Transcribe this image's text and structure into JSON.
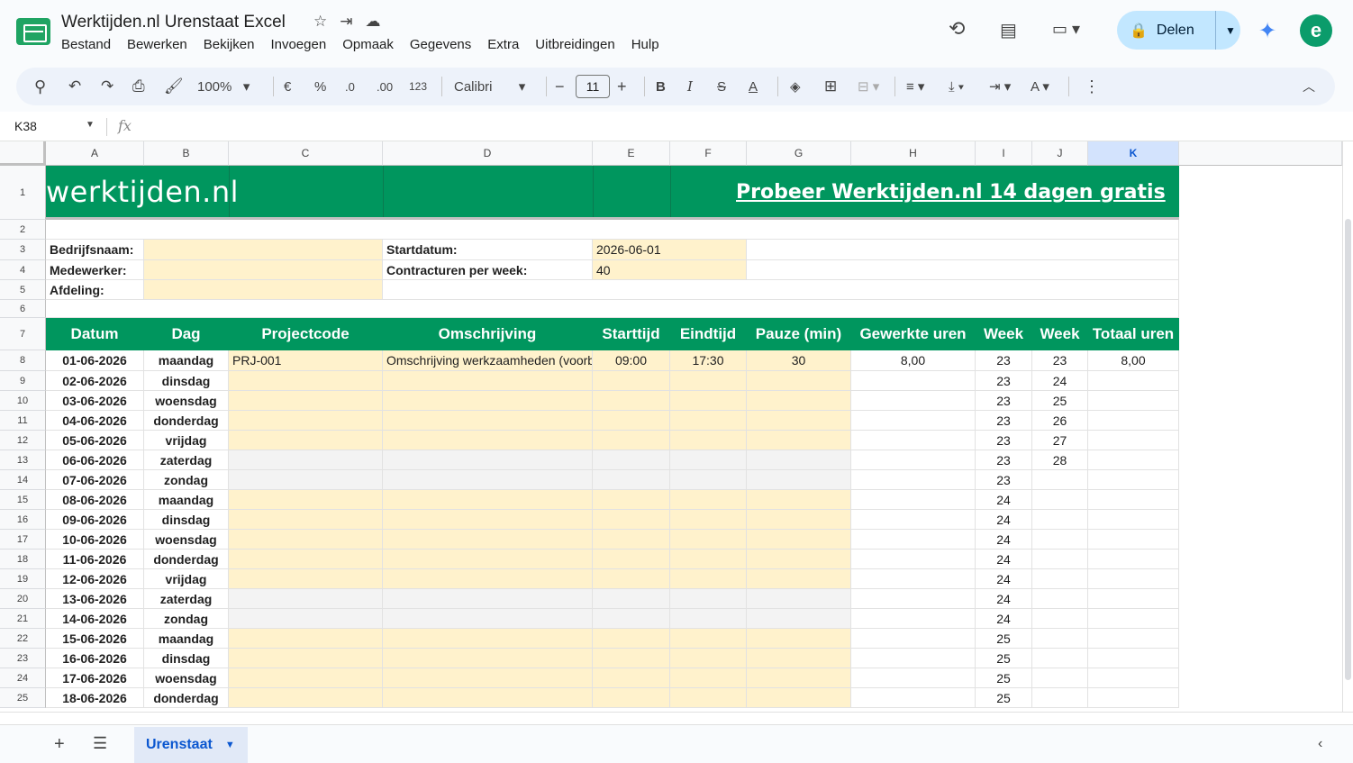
{
  "app": {
    "title": "Werktijden.nl Urenstaat Excel",
    "menu": [
      "Bestand",
      "Bewerken",
      "Bekijken",
      "Invoegen",
      "Opmaak",
      "Gegevens",
      "Extra",
      "Uitbreidingen",
      "Hulp"
    ],
    "share_label": "Delen",
    "avatar_letter": "e"
  },
  "toolbar": {
    "zoom": "100%",
    "currency": "€",
    "percent": "%",
    "dec_less": ".0",
    "dec_more": ".00",
    "number_format": "123",
    "font": "Calibri",
    "font_size": "11"
  },
  "formula_bar": {
    "cell_ref": "K38",
    "fx": "fx",
    "value": ""
  },
  "columns": [
    "A",
    "B",
    "C",
    "D",
    "E",
    "F",
    "G",
    "H",
    "I",
    "J",
    "K"
  ],
  "selected_column": "K",
  "banner": {
    "brand": "werktijden.nl",
    "promo": "Probeer Werktijden.nl 14 dagen gratis"
  },
  "form": {
    "bedrijfsnaam_label": "Bedrijfsnaam:",
    "medewerker_label": "Medewerker:",
    "afdeling_label": "Afdeling:",
    "startdatum_label": "Startdatum:",
    "startdatum_value": "2026-06-01",
    "contracturen_label": "Contracturen per week:",
    "contracturen_value": "40"
  },
  "table_headers": [
    "Datum",
    "Dag",
    "Projectcode",
    "Omschrijving",
    "Starttijd",
    "Eindtijd",
    "Pauze (min)",
    "Gewerkte uren",
    "Week",
    "Week",
    "Totaal uren"
  ],
  "rows": [
    {
      "num": "8",
      "datum": "01-06-2026",
      "dag": "maandag",
      "project": "PRJ-001",
      "omschrijving": "Omschrijving werkzaamheden (voorbeeld)",
      "start": "09:00",
      "eind": "17:30",
      "pauze": "30",
      "uren": "8,00",
      "week": "23",
      "week2": "23",
      "totaal": "8,00",
      "weekend": false
    },
    {
      "num": "9",
      "datum": "02-06-2026",
      "dag": "dinsdag",
      "project": "",
      "omschrijving": "",
      "start": "",
      "eind": "",
      "pauze": "",
      "uren": "",
      "week": "23",
      "week2": "24",
      "totaal": "",
      "weekend": false
    },
    {
      "num": "10",
      "datum": "03-06-2026",
      "dag": "woensdag",
      "project": "",
      "omschrijving": "",
      "start": "",
      "eind": "",
      "pauze": "",
      "uren": "",
      "week": "23",
      "week2": "25",
      "totaal": "",
      "weekend": false
    },
    {
      "num": "11",
      "datum": "04-06-2026",
      "dag": "donderdag",
      "project": "",
      "omschrijving": "",
      "start": "",
      "eind": "",
      "pauze": "",
      "uren": "",
      "week": "23",
      "week2": "26",
      "totaal": "",
      "weekend": false
    },
    {
      "num": "12",
      "datum": "05-06-2026",
      "dag": "vrijdag",
      "project": "",
      "omschrijving": "",
      "start": "",
      "eind": "",
      "pauze": "",
      "uren": "",
      "week": "23",
      "week2": "27",
      "totaal": "",
      "weekend": false
    },
    {
      "num": "13",
      "datum": "06-06-2026",
      "dag": "zaterdag",
      "project": "",
      "omschrijving": "",
      "start": "",
      "eind": "",
      "pauze": "",
      "uren": "",
      "week": "23",
      "week2": "28",
      "totaal": "",
      "weekend": true
    },
    {
      "num": "14",
      "datum": "07-06-2026",
      "dag": "zondag",
      "project": "",
      "omschrijving": "",
      "start": "",
      "eind": "",
      "pauze": "",
      "uren": "",
      "week": "23",
      "week2": "",
      "totaal": "",
      "weekend": true
    },
    {
      "num": "15",
      "datum": "08-06-2026",
      "dag": "maandag",
      "project": "",
      "omschrijving": "",
      "start": "",
      "eind": "",
      "pauze": "",
      "uren": "",
      "week": "24",
      "week2": "",
      "totaal": "",
      "weekend": false
    },
    {
      "num": "16",
      "datum": "09-06-2026",
      "dag": "dinsdag",
      "project": "",
      "omschrijving": "",
      "start": "",
      "eind": "",
      "pauze": "",
      "uren": "",
      "week": "24",
      "week2": "",
      "totaal": "",
      "weekend": false
    },
    {
      "num": "17",
      "datum": "10-06-2026",
      "dag": "woensdag",
      "project": "",
      "omschrijving": "",
      "start": "",
      "eind": "",
      "pauze": "",
      "uren": "",
      "week": "24",
      "week2": "",
      "totaal": "",
      "weekend": false
    },
    {
      "num": "18",
      "datum": "11-06-2026",
      "dag": "donderdag",
      "project": "",
      "omschrijving": "",
      "start": "",
      "eind": "",
      "pauze": "",
      "uren": "",
      "week": "24",
      "week2": "",
      "totaal": "",
      "weekend": false
    },
    {
      "num": "19",
      "datum": "12-06-2026",
      "dag": "vrijdag",
      "project": "",
      "omschrijving": "",
      "start": "",
      "eind": "",
      "pauze": "",
      "uren": "",
      "week": "24",
      "week2": "",
      "totaal": "",
      "weekend": false
    },
    {
      "num": "20",
      "datum": "13-06-2026",
      "dag": "zaterdag",
      "project": "",
      "omschrijving": "",
      "start": "",
      "eind": "",
      "pauze": "",
      "uren": "",
      "week": "24",
      "week2": "",
      "totaal": "",
      "weekend": true
    },
    {
      "num": "21",
      "datum": "14-06-2026",
      "dag": "zondag",
      "project": "",
      "omschrijving": "",
      "start": "",
      "eind": "",
      "pauze": "",
      "uren": "",
      "week": "24",
      "week2": "",
      "totaal": "",
      "weekend": true
    },
    {
      "num": "22",
      "datum": "15-06-2026",
      "dag": "maandag",
      "project": "",
      "omschrijving": "",
      "start": "",
      "eind": "",
      "pauze": "",
      "uren": "",
      "week": "25",
      "week2": "",
      "totaal": "",
      "weekend": false
    },
    {
      "num": "23",
      "datum": "16-06-2026",
      "dag": "dinsdag",
      "project": "",
      "omschrijving": "",
      "start": "",
      "eind": "",
      "pauze": "",
      "uren": "",
      "week": "25",
      "week2": "",
      "totaal": "",
      "weekend": false
    },
    {
      "num": "24",
      "datum": "17-06-2026",
      "dag": "woensdag",
      "project": "",
      "omschrijving": "",
      "start": "",
      "eind": "",
      "pauze": "",
      "uren": "",
      "week": "25",
      "week2": "",
      "totaal": "",
      "weekend": false
    },
    {
      "num": "25",
      "datum": "18-06-2026",
      "dag": "donderdag",
      "project": "",
      "omschrijving": "",
      "start": "",
      "eind": "",
      "pauze": "",
      "uren": "",
      "week": "25",
      "week2": "",
      "totaal": "",
      "weekend": false
    }
  ],
  "sheet": {
    "tab_name": "Urenstaat"
  },
  "colors": {
    "brand_green": "#00965e",
    "input_yellow": "#fff2cc",
    "weekend_gray": "#f3f3f3",
    "share_blue": "#c2e7ff"
  }
}
